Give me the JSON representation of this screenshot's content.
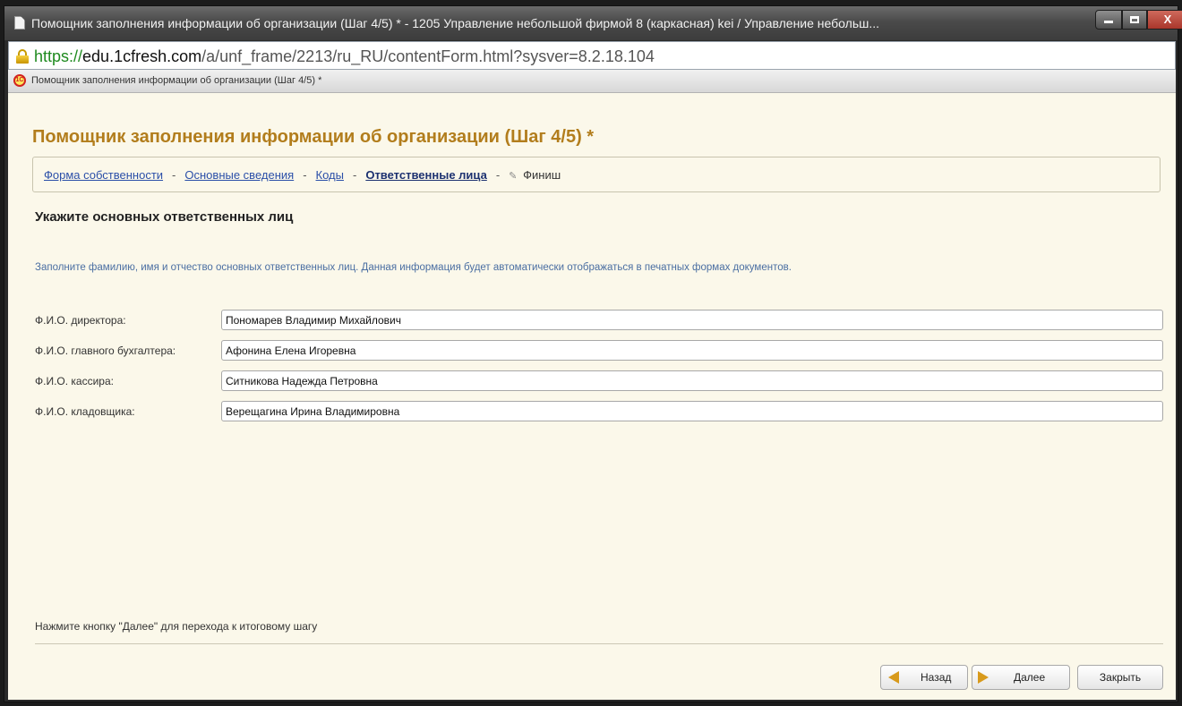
{
  "window": {
    "title": "Помощник заполнения информации об организации (Шаг 4/5) * - 1205 Управление небольшой фирмой 8 (каркасная) kei / Управление небольш...",
    "minimize_glyph": "",
    "maximize_glyph": "",
    "close_glyph": "X"
  },
  "address_bar": {
    "scheme": "https://",
    "host": "edu.1cfresh.com",
    "path": "/a/unf_frame/2213/ru_RU/contentForm.html?sysver=8.2.18.104"
  },
  "tab": {
    "logo_text": "1С",
    "title": "Помощник заполнения информации об организации (Шаг 4/5) *"
  },
  "form": {
    "title": "Помощник заполнения информации об организации (Шаг 4/5) *",
    "steps": [
      {
        "label": "Форма собственности"
      },
      {
        "label": "Основные сведения"
      },
      {
        "label": "Коды"
      },
      {
        "label": "Ответственные лица"
      },
      {
        "label": "Финиш"
      }
    ],
    "separator": "-",
    "section_title": "Укажите основных ответственных лиц",
    "hint": "Заполните фамилию, имя и отчество основных ответственных лиц. Данная информация будет автоматически отображаться в печатных формах документов.",
    "fields": [
      {
        "label": "Ф.И.О. директора:",
        "value": "Пономарев Владимир Михайлович"
      },
      {
        "label": "Ф.И.О. главного бухгалтера:",
        "value": "Афонина Елена Игоревна"
      },
      {
        "label": "Ф.И.О. кассира:",
        "value": "Ситникова Надежда Петровна"
      },
      {
        "label": "Ф.И.О. кладовщика:",
        "value": "Верещагина Ирина Владимировна"
      }
    ],
    "footer_hint": "Нажмите кнопку \"Далее\" для перехода к итоговому шагу",
    "buttons": {
      "back": "Назад",
      "next": "Далее",
      "close": "Закрыть"
    }
  },
  "colors": {
    "form_title": "#b27d1c",
    "link": "#2b4fa8",
    "hint": "#4a6ea2",
    "content_bg": "#fbf8ea"
  }
}
